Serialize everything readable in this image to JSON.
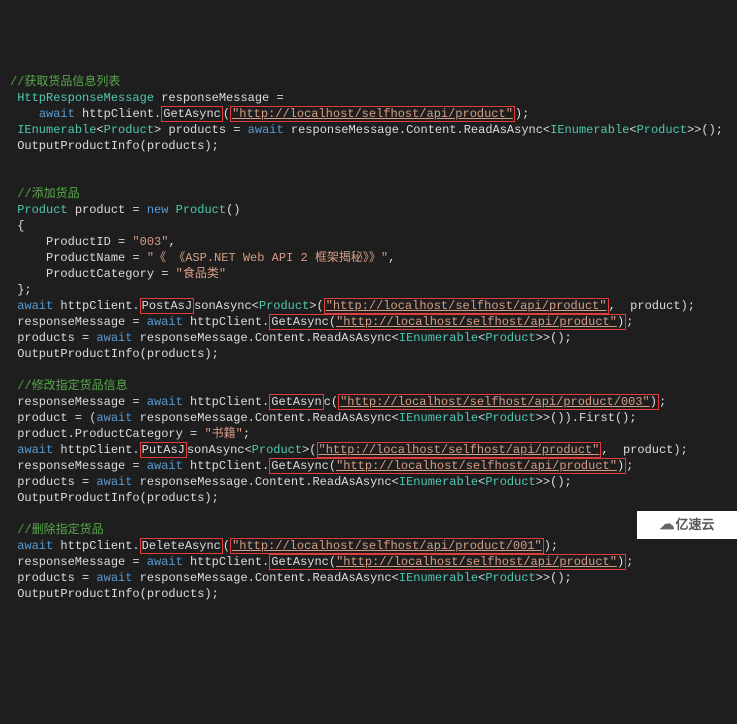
{
  "code": {
    "cmt1": "//获取货品信息列表",
    "line1_1": " responseMessage =",
    "line2_1": "await",
    "line2_3": "GetAsync",
    "url1": "\"http://localhost/selfhost/api/product\"",
    "line3_1": "<",
    "line3_3": "> products = ",
    "line3_4": "await",
    "line3_5": " responseMessage.Content.ReadAsAsync<",
    "line3_7": "<",
    "line3_9": ">>();",
    "line4": " OutputProductInfo(products);",
    "cmt2": "//添加货品",
    "line5_1": " product = ",
    "line5_2": "new",
    "line5_4": "()",
    "line6": " {",
    "line7_1": "     ProductID = ",
    "line7_2": "\"003\"",
    "line7_3": ",",
    "line8_1": "     ProductName = ",
    "line8_2": "\"《 《ASP.NET Web API 2 框架揭秘》》\"",
    "line8_3": ",",
    "line9_1": "     ProductCategory = ",
    "line9_2": "\"食品类\"",
    "line10": " };",
    "line11_1": "await",
    "line11_2": " httpClient.",
    "line11_3": "PostAsJ",
    "line11_4": "sonAsync<",
    "line11_6": ">(",
    "url2": "\"http://localhost/selfhost/api/product\"",
    "line11_8": ",  product);",
    "line12_1": " responseMessage = ",
    "line12_2": "await",
    "line12_3": " httpClient.",
    "line12_4": "GetAsync",
    "url3": "\"http://localhost/selfhost/api/product\"",
    "line12_6": ";",
    "line13_1": " products = ",
    "line13_2": "await",
    "line13_3": " responseMessage.Content.ReadAsAsync<",
    "line13_5": "<",
    "line13_7": ">>();",
    "line14": " OutputProductInfo(products);",
    "cmt3": "//修改指定货品信息",
    "line15_1": " responseMessage = ",
    "line15_2": "await",
    "line15_3": " httpClient.",
    "line15_4": "GetAsyn",
    "url4": "\"http://localhost/selfhost/api/product/003\"",
    "line15_6": ";",
    "line16_1": " product = (",
    "line16_2": "await",
    "line16_3": " responseMessage.Content.ReadAsAsync<",
    "line16_5": "<",
    "line16_7": ">>()).First();",
    "line17_1": " product.ProductCategory = ",
    "line17_2": "\"书籍\"",
    "line17_3": ";",
    "line18_1": "await",
    "line18_2": " httpClient.",
    "line18_3": "PutAsJ",
    "line18_4": "sonAsync<",
    "url5": "\"http://localhost/selfhost/api/product\"",
    "line18_7": ",  product);",
    "line19_1": " responseMessage = ",
    "line19_2": "await",
    "line19_3": " httpClient.",
    "line19_4": "GetAsync",
    "url6": "\"http://localhost/selfhost/api/product\"",
    "line19_6": ";",
    "line20_1": " products = ",
    "line20_2": "await",
    "line20_3": " responseMessage.Content.ReadAsAsync<",
    "line20_5": "<",
    "line20_7": ">>();",
    "line21": " OutputProductInfo(products);",
    "cmt4": "//删除指定货品",
    "line22_1": "await",
    "line22_2": " httpClient.",
    "line22_3": "DeleteAsync",
    "url7": "\"http://localhost/selfhost/api/product/001\"",
    "line22_5": ";",
    "line23_1": " responseMessage = ",
    "line23_2": "await",
    "line23_3": " httpClient.",
    "line23_4": "GetAsync",
    "url8": "\"http://localhost/selfhost/api/product\"",
    "line23_6": ";",
    "line24_1": " products = ",
    "line24_2": "await",
    "line24_3": " responseMessage.Content.ReadAsAsync<",
    "line24_5": "<",
    "line24_7": ">>();",
    "line25": " OutputProductInfo(products);",
    "type_HttpResponseMessage": "HttpResponseMessage",
    "type_IEnumerable": "IEnumerable",
    "type_Product": "Product"
  },
  "watermark": "亿速云"
}
